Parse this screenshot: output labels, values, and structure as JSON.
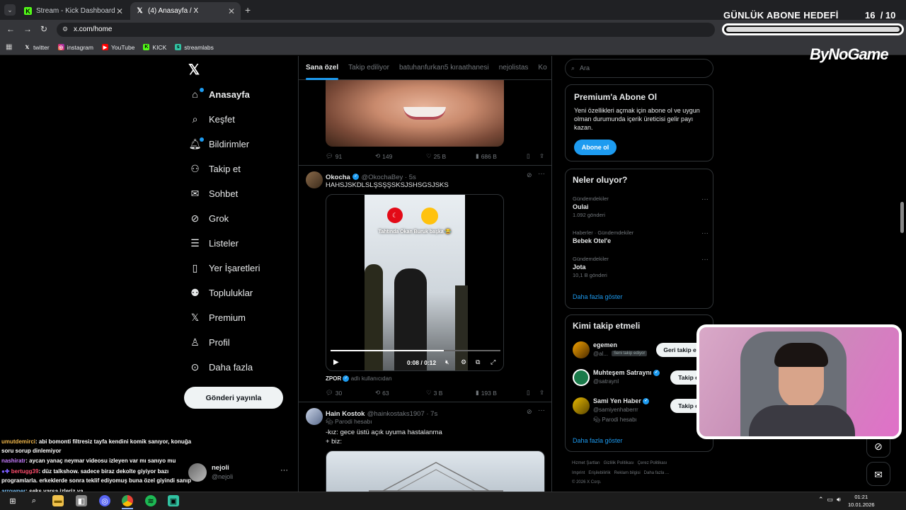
{
  "browser": {
    "tabs": [
      {
        "label": "Stream - Kick Dashboard"
      },
      {
        "label": "(4) Anasayfa / X"
      }
    ],
    "url": "x.com/home",
    "bookmarks": [
      {
        "label": "twitter"
      },
      {
        "label": "instagram"
      },
      {
        "label": "YouTube"
      },
      {
        "label": "KICK"
      },
      {
        "label": "streamlabs"
      }
    ]
  },
  "overlay": {
    "goal_title": "GÜNLÜK ABONE HEDEFİ",
    "goal_current": "16",
    "goal_total": "/ 10",
    "goal_progress": 1.0,
    "brand": "ByNoGame"
  },
  "sidebar": {
    "items": [
      {
        "label": "Anasayfa",
        "icon": "home-icon"
      },
      {
        "label": "Keşfet",
        "icon": "search-icon"
      },
      {
        "label": "Bildirimler",
        "icon": "bell-icon"
      },
      {
        "label": "Takip et",
        "icon": "person-add-icon"
      },
      {
        "label": "Sohbet",
        "icon": "mail-icon"
      },
      {
        "label": "Grok",
        "icon": "grok-icon"
      },
      {
        "label": "Listeler",
        "icon": "list-icon"
      },
      {
        "label": "Yer İşaretleri",
        "icon": "bookmark-icon"
      },
      {
        "label": "Topluluklar",
        "icon": "people-icon"
      },
      {
        "label": "Premium",
        "icon": "x-logo-icon"
      },
      {
        "label": "Profil",
        "icon": "person-icon"
      },
      {
        "label": "Daha fazla",
        "icon": "more-circle-icon"
      }
    ],
    "post_button": "Gönderi yayınla",
    "profile": {
      "name": "nejoli",
      "handle": "@nejoli"
    }
  },
  "feed": {
    "tabs": [
      "Sana özel",
      "Takip ediliyor",
      "batuhanfurkan5 kıraathanesi",
      "nejolistas",
      "Ko"
    ],
    "tweet1_actions": {
      "replies": "91",
      "retweets": "149",
      "likes": "25 B",
      "views": "686 B"
    },
    "tweet2": {
      "name": "Okocha",
      "handle": "@OkochaBey · 5s",
      "text": "HAHSJSKDLSLŞSŞŞSKSJSHSGSJSKS",
      "video_time": "0:08 / 0:12",
      "video_caption": "Tahtında Okan Buruk başka 😂",
      "source_user": "ZPOR",
      "source_suffix": "adlı kullanıcıdan",
      "replies": "30",
      "retweets": "63",
      "likes": "3 B",
      "views": "193 B"
    },
    "tweet3": {
      "name": "Hain Kostok",
      "handle": "@hainkostaks1907 · 7s",
      "badge": "Parodi hesabı",
      "text_line1": "-kız: gece üstü açık uyuma hastalanma",
      "text_line2": "+ biz:"
    }
  },
  "right": {
    "search_placeholder": "Ara",
    "premium": {
      "title": "Premium'a Abone Ol",
      "body": "Yeni özellikleri açmak için abone ol ve uygun olman durumunda içerik üreticisi gelir payı kazan.",
      "button": "Abone ol"
    },
    "trends": {
      "title": "Neler oluyor?",
      "items": [
        {
          "meta": "Gündemdekiler",
          "name": "Oulai",
          "count": "1.092 gönderi"
        },
        {
          "meta": "Haberler · Gündemdekiler",
          "name": "Bebek Otel'e",
          "count": ""
        },
        {
          "meta": "Gündemdekiler",
          "name": "Jota",
          "count": "10,1 B gönderi"
        }
      ],
      "more": "Daha fazla göster"
    },
    "who_to_follow": {
      "title": "Kimi takip etmeli",
      "items": [
        {
          "name": "egemen",
          "handle": "@al...",
          "tag": "Seni takip ediyor",
          "button": "Geri takip et"
        },
        {
          "name": "Muhteşem Satraynı",
          "handle": "@satraynl",
          "tag": "",
          "button": "Takip et"
        },
        {
          "name": "Sami Yen Haber",
          "handle": "@samiyenhaberrr",
          "tag": "Parodi hesabı",
          "button": "Takip et"
        }
      ],
      "more": "Daha fazla göster"
    },
    "footer": {
      "line1": "Hizmet Şartları   Gizlilik Politikası   Çerez Politikası",
      "line2": "Imprint   Erişilebilirlik   Reklam bilgisi   Daha fazla ...",
      "copyright": "© 2026 X Corp."
    }
  },
  "chat": [
    {
      "user": "umutdemirci",
      "text": ": abi bomonti filtresiz tayfa kendini komik sanıyor, konuğa soru sorup dinlemiyor",
      "color": "#f2b84b"
    },
    {
      "user": "nashiratr",
      "text": ": aycan yanaç neymar videosu izleyen var mı sanıyo mu",
      "color": "#c77dff"
    },
    {
      "user": "bertugg39",
      "text": ": düz talkshow. sadece biraz dekolte giyiyor bazı programlarla. erkeklerde sonra teklif ediyomuş buna özel giyindi sanıp",
      "color": "#ff4d6d"
    },
    {
      "user": "arrowner",
      "text": ": seks varsa izleriz ya",
      "color": "#7ec8ff"
    }
  ],
  "taskbar": {
    "time": "01:21",
    "date": "10.01.2026"
  }
}
